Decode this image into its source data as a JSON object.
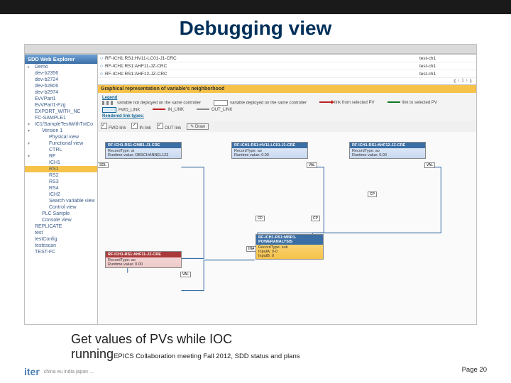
{
  "title": "Debugging view",
  "sidebar": {
    "header": "SDD Web Explorer",
    "items": [
      {
        "label": "Demo",
        "caret": true
      },
      {
        "label": "dev-b2356"
      },
      {
        "label": "dev-b2724"
      },
      {
        "label": "dev-b2806"
      },
      {
        "label": "dev-b2974"
      },
      {
        "label": "EvVPart1"
      },
      {
        "label": "EvVPart1-Fzg"
      },
      {
        "label": "EXPORT_WITH_NC"
      },
      {
        "label": "FC-SAMPLE1"
      },
      {
        "label": "IC1/SampleTestWithTxtCo",
        "caret": true,
        "open": true
      },
      {
        "label": "Version 1",
        "lvl": 2,
        "caret": true,
        "open": true
      },
      {
        "label": "Physical view",
        "lvl": 3
      },
      {
        "label": "Functional view",
        "lvl": 3,
        "caret": true,
        "open": true
      },
      {
        "label": "CTRL",
        "lvl": 3
      },
      {
        "label": "RF",
        "lvl": 3,
        "caret": true,
        "open": true
      },
      {
        "label": "ICH1",
        "lvl": 3
      },
      {
        "label": "RS1",
        "lvl": 3,
        "sel": true
      },
      {
        "label": "RS2",
        "lvl": 3
      },
      {
        "label": "RS3",
        "lvl": 3
      },
      {
        "label": "RS4",
        "lvl": 3
      },
      {
        "label": "ICH2",
        "lvl": 3
      },
      {
        "label": "Search variable view",
        "lvl": 3
      },
      {
        "label": "Control view",
        "lvl": 3
      },
      {
        "label": "PLC Sample",
        "lvl": 2
      },
      {
        "label": "Console view",
        "lvl": 2
      },
      {
        "label": "REPLICATE"
      },
      {
        "label": "test"
      },
      {
        "label": "testConfig"
      },
      {
        "label": "testescan"
      },
      {
        "label": "TEST-FC"
      }
    ]
  },
  "table": {
    "rows": [
      {
        "icon": "○",
        "name": "RF-ICH1:RS1:HV11-LC01-J1-CRC",
        "val": "test-ch1"
      },
      {
        "icon": "○",
        "name": "RF-ICH1:RS1:AHF11-JZ-CRC",
        "val": "test-ch1"
      },
      {
        "icon": "○",
        "name": "RF-ICH1:RS1:AHF12-JZ-CRC",
        "val": "test-ch1"
      }
    ],
    "pager": [
      "⟪",
      "‹",
      "1",
      "›",
      "⟫"
    ]
  },
  "section_header": "Graphical representation of variable's neighborhood",
  "legend": {
    "title": "Legend",
    "row1": [
      {
        "txt": "variable not deployed on the same controller"
      },
      {
        "txt": "variable deployed on the same controller"
      },
      {
        "txt": "link from selected PV"
      },
      {
        "txt": "link to selected PV"
      }
    ],
    "row2": [
      {
        "txt": "FWD_LINK"
      },
      {
        "txt": "IN_LINK"
      },
      {
        "txt": "OUT_LINK"
      }
    ],
    "linktypes_title": "Rendered link types:",
    "opts": [
      "FWD link",
      "IN link",
      "OUT link"
    ],
    "draw": "Draw"
  },
  "nodes": {
    "a": {
      "name": "RF-ICH1-RS1:GMB1-J1-CRE",
      "l1": "RecordType: ai",
      "l2": "Runtime value: OBSCHANNEL123"
    },
    "b": {
      "name": "RF-ICH1-RS1:AHF11-JZ-CRE",
      "l1": "RecordType: ao",
      "l2": "Runtime value: 0.00"
    },
    "c": {
      "name": "RF-ICH1-RS1:HV11-LC01-J1-CRE",
      "l1": "RecordType: ao",
      "l2": "Runtime value: 0.00"
    },
    "d": {
      "name": "RF-ICH1-RS1:AHF12-JZ-CRE",
      "l1": "RecordType: ao",
      "l2": "Runtime value: 0.00"
    },
    "e": {
      "name": "RF-ICH1-RS1:MBR1-POWERANALYSIS",
      "l1": "RecordType: sub",
      "l2": "InputA: 0-0",
      "l3": "InputB: 0"
    },
    "port_sdl": "SDL",
    "port_val": "VAL",
    "port_cp": "CP",
    "port_ina": "INA"
  },
  "caption_line1": "Get values of PVs while IOC",
  "caption_line2": "running",
  "footer_mid": "EPICS Collaboration meeting  Fall 2012, SDD status and plans",
  "footer_page": "Page 20",
  "footer_flags": "china eu india japan ..."
}
